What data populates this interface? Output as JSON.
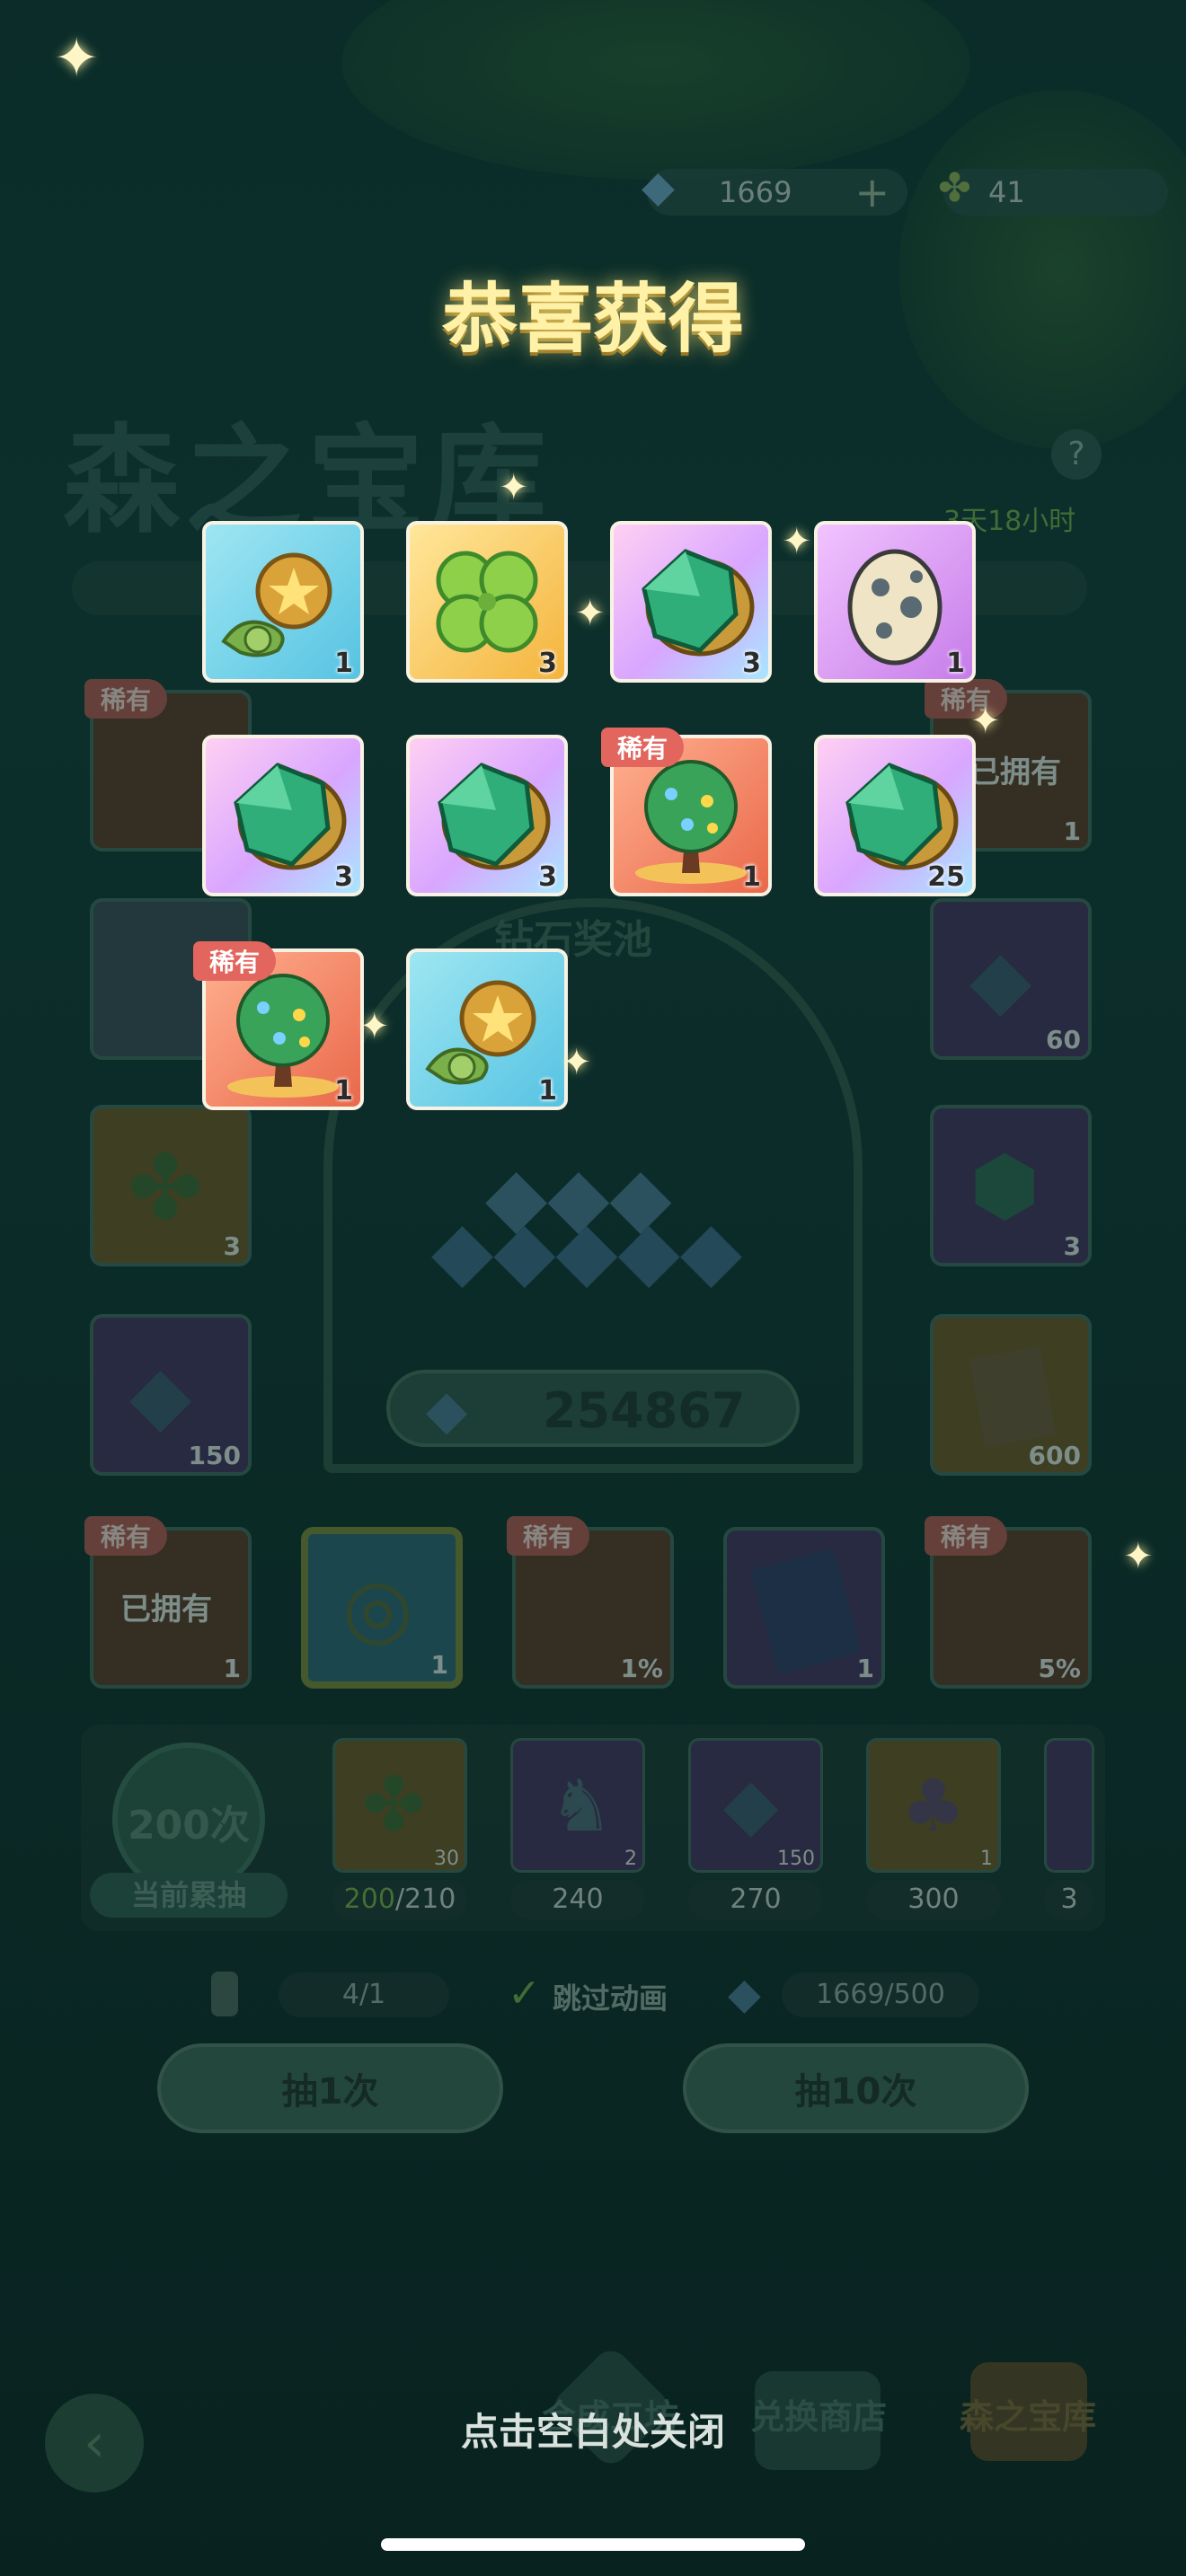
{
  "currency": {
    "diamonds": "1669",
    "clovers": "41",
    "plus": "+"
  },
  "background": {
    "title": "森之宝库",
    "timer": "3天18小时",
    "help": "?",
    "pool_label": "钻石奖池",
    "pool_total": "254867",
    "rare_tag": "稀有",
    "owned": "已拥有",
    "percent_a": "1%",
    "percent_b": "5%",
    "slot_counts": [
      "1",
      "60",
      "3",
      "3",
      "150",
      "600",
      "1",
      "1",
      "1"
    ],
    "progress": {
      "count_label": "200次",
      "current_label": "当前累抽",
      "current": "200",
      "total": "/210"
    },
    "milestones": [
      {
        "threshold": "240",
        "count": "2",
        "icon": "robot-figure"
      },
      {
        "threshold": "270",
        "count": "150",
        "icon": "diamond"
      },
      {
        "threshold": "300",
        "count": "1",
        "icon": "gem-bag"
      },
      {
        "threshold": "3",
        "count": "",
        "icon": "robot-figure"
      }
    ],
    "first_milestone": {
      "count": "30",
      "icon": "clover"
    },
    "ticket": "4/1",
    "skip_anim": "跳过动画",
    "diamond_cost": "1669/500",
    "draw1": "抽1次",
    "draw10": "抽10次",
    "nav": {
      "craft": "合成工坊",
      "shop": "兑换商店",
      "vault": "森之宝库"
    }
  },
  "reward_popup": {
    "title": "恭喜获得",
    "close_hint": "点击空白处关闭",
    "items": [
      {
        "icon": "coin-snail",
        "count": "1",
        "color": "blue",
        "tag": ""
      },
      {
        "icon": "clover",
        "count": "3",
        "color": "gold",
        "tag": ""
      },
      {
        "icon": "emerald-coin",
        "count": "3",
        "color": "pink",
        "tag": ""
      },
      {
        "icon": "spotted-egg",
        "count": "1",
        "color": "purple",
        "tag": ""
      },
      {
        "icon": "emerald-coin",
        "count": "3",
        "color": "pink",
        "tag": ""
      },
      {
        "icon": "emerald-coin",
        "count": "3",
        "color": "pink",
        "tag": ""
      },
      {
        "icon": "gem-tree",
        "count": "1",
        "color": "red",
        "tag": "稀有"
      },
      {
        "icon": "emerald-coin",
        "count": "25",
        "color": "pink",
        "tag": ""
      },
      {
        "icon": "gem-tree",
        "count": "1",
        "color": "red",
        "tag": "稀有"
      },
      {
        "icon": "coin-snail",
        "count": "1",
        "color": "blue",
        "tag": ""
      }
    ]
  }
}
